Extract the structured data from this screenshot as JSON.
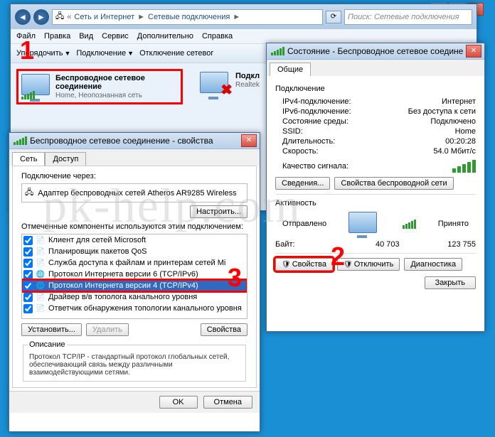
{
  "explorer": {
    "breadcrumb": [
      "Сеть и Интернет",
      "Сетевые подключения"
    ],
    "search_placeholder": "Поиск: Сетевые подключения",
    "menu": [
      "Файл",
      "Правка",
      "Вид",
      "Сервис",
      "Дополнительно",
      "Справка"
    ],
    "toolbar": {
      "organize": "Упорядочить",
      "connect": "Подключение",
      "disconnect": "Отключение сетевог"
    },
    "connections": [
      {
        "name": "Беспроводное сетевое соединение",
        "sub": "Home, Неопознанная сеть",
        "selected": true,
        "error": false
      },
      {
        "name": "Подкл",
        "sub": "Realtek",
        "selected": false,
        "error": true
      }
    ]
  },
  "status": {
    "title": "Состояние - Беспроводное сетевое соединение",
    "tab": "Общие",
    "group1": "Подключение",
    "rows": [
      {
        "k": "IPv4-подключение:",
        "v": "Интернет"
      },
      {
        "k": "IPv6-подключение:",
        "v": "Без доступа к сети"
      },
      {
        "k": "Состояние среды:",
        "v": "Подключено"
      },
      {
        "k": "SSID:",
        "v": "Home"
      },
      {
        "k": "Длительность:",
        "v": "00:20:28"
      },
      {
        "k": "Скорость:",
        "v": "54.0 Мбит/с"
      }
    ],
    "signal_label": "Качество сигнала:",
    "details_btn": "Сведения...",
    "wprops_btn": "Свойства беспроводной сети",
    "activity": "Активность",
    "sent": "Отправлено",
    "recv": "Принято",
    "bytes_label": "Байт:",
    "sent_v": "40 703",
    "recv_v": "123 755",
    "props_btn": "Свойства",
    "disable_btn": "Отключить",
    "diag_btn": "Диагностика",
    "close_btn": "Закрыть"
  },
  "props": {
    "title": "Беспроводное сетевое соединение - свойства",
    "tabs": [
      "Сеть",
      "Доступ"
    ],
    "connect_via": "Подключение через:",
    "adapter": "Адаптер беспроводных сетей Atheros AR9285 Wireless",
    "configure": "Настроить...",
    "comp_label": "Отмеченные компоненты используются этим подключением:",
    "items": [
      {
        "t": "Клиент для сетей Microsoft",
        "c": true
      },
      {
        "t": "Планировщик пакетов QoS",
        "c": true
      },
      {
        "t": "Служба доступа к файлам и принтерам сетей Mi",
        "c": true
      },
      {
        "t": "Протокол Интернета версии 6 (TCP/IPv6)",
        "c": true
      },
      {
        "t": "Протокол Интернета версии 4 (TCP/IPv4)",
        "c": true,
        "sel": true
      },
      {
        "t": "Драйвер в/в тополога канального уровня",
        "c": true
      },
      {
        "t": "Ответчик обнаружения топологии канального уровня",
        "c": true
      }
    ],
    "install": "Установить...",
    "remove": "Удалить",
    "props": "Свойства",
    "desc_label": "Описание",
    "desc": "Протокол TCP/IP - стандартный протокол глобальных сетей, обеспечивающий связь между различными взаимодействующими сетями.",
    "ok": "OK",
    "cancel": "Отмена"
  },
  "markers": {
    "m1": "1",
    "m2": "2",
    "m3": "3"
  },
  "watermark": "pk-help.com"
}
